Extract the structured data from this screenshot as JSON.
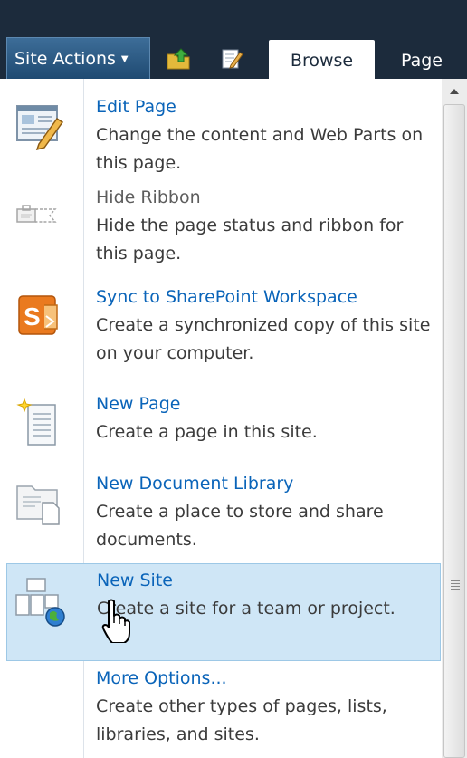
{
  "topbar": {
    "site_actions_label": "Site Actions",
    "tabs": [
      {
        "label": "Browse",
        "active": true
      },
      {
        "label": "Page",
        "active": false
      }
    ],
    "icons": [
      "navigate-up-icon",
      "edit-icon"
    ]
  },
  "menu": {
    "items": [
      {
        "title": "Edit Page",
        "description": "Change the content and Web Parts on this page.",
        "icon": "edit-page-icon"
      },
      {
        "title": "Hide Ribbon",
        "description": "Hide the page status and ribbon for this page.",
        "icon": "hide-ribbon-icon",
        "disabled": true
      },
      {
        "title": "Sync to SharePoint Workspace",
        "description": "Create a synchronized copy of this site on your computer.",
        "icon": "sharepoint-workspace-icon"
      },
      {
        "title": "New Page",
        "description": "Create a page in this site.",
        "icon": "new-page-icon"
      },
      {
        "title": "New Document Library",
        "description": "Create a place to store and share documents.",
        "icon": "new-document-library-icon"
      },
      {
        "title": "New Site",
        "description": "Create a site for a team or project.",
        "icon": "new-site-icon",
        "highlighted": true
      },
      {
        "title": "More Options...",
        "description": "Create other types of pages, lists, libraries, and sites.",
        "icon": "none"
      }
    ]
  },
  "colors": {
    "topbar_bg": "#1c2b3c",
    "link_blue": "#0a64b9",
    "hover_bg": "#cfe6f6"
  }
}
